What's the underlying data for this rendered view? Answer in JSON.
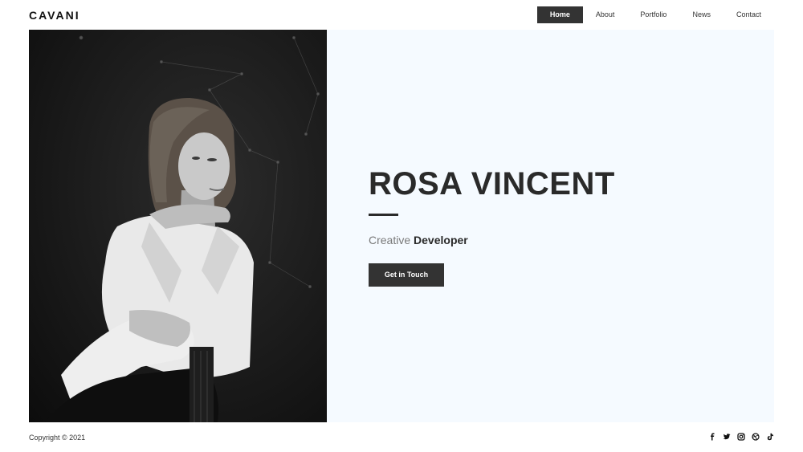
{
  "header": {
    "logo": "CAVANI",
    "nav": [
      {
        "label": "Home",
        "active": true
      },
      {
        "label": "About",
        "active": false
      },
      {
        "label": "Portfolio",
        "active": false
      },
      {
        "label": "News",
        "active": false
      },
      {
        "label": "Contact",
        "active": false
      }
    ]
  },
  "hero": {
    "name": "ROSA VINCENT",
    "role_prefix": "Creative",
    "role_main": "Developer",
    "cta_label": "Get in Touch",
    "photo_icon": "portrait-photo"
  },
  "footer": {
    "copyright": "Copyright © 2021",
    "socials": [
      "facebook-icon",
      "twitter-icon",
      "instagram-icon",
      "dribbble-icon",
      "tiktok-icon"
    ]
  },
  "colors": {
    "accent": "#333333",
    "hero_bg": "#f5faff"
  }
}
